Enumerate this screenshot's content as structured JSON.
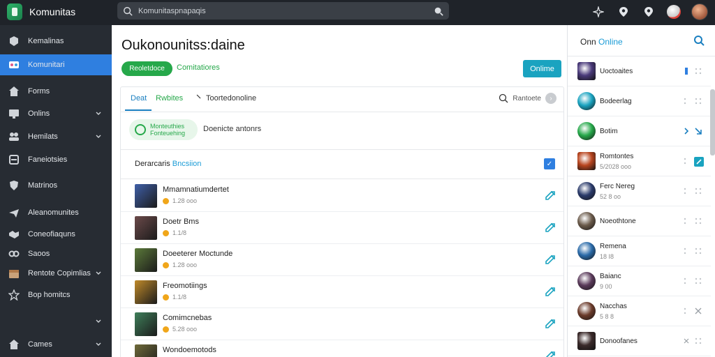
{
  "app": {
    "name": "Komunitas"
  },
  "search": {
    "placeholder": "Komunitaspnapaqis"
  },
  "sidebar": {
    "items": [
      {
        "label": "Kemalinas",
        "icon": "cube-icon",
        "chevron": false,
        "active": false
      },
      {
        "label": "Komunitari",
        "icon": "community-icon",
        "chevron": false,
        "active": true
      },
      {
        "label": "Forms",
        "icon": "house-icon",
        "chevron": false,
        "active": false
      },
      {
        "label": "Onlins",
        "icon": "monitor-icon",
        "chevron": true,
        "active": false
      },
      {
        "label": "Hemilats",
        "icon": "users-icon",
        "chevron": true,
        "active": false
      },
      {
        "label": "Faneiotsies",
        "icon": "tools-icon",
        "chevron": false,
        "active": false
      },
      {
        "label": "Matrinos",
        "icon": "shield-icon",
        "chevron": false,
        "active": false
      },
      {
        "label": "Aleanomunites",
        "icon": "plane-icon",
        "chevron": false,
        "active": false
      },
      {
        "label": "Coneofiaquns",
        "icon": "handshake-icon",
        "chevron": false,
        "active": false
      },
      {
        "label": "Saoos",
        "icon": "link-icon",
        "chevron": false,
        "active": false
      },
      {
        "label": "Rentote Copimlias",
        "icon": "calendar-icon",
        "chevron": true,
        "active": false
      },
      {
        "label": "Bop homitcs",
        "icon": "star-icon",
        "chevron": false,
        "active": false
      },
      {
        "label": "",
        "icon": "",
        "chevron": true,
        "active": false
      },
      {
        "label": "Cames",
        "icon": "home-icon",
        "chevron": true,
        "active": false
      }
    ]
  },
  "main": {
    "title": "Oukonounitss:daine",
    "green_button": "Reoletdoce",
    "green_link": "Comitatiores",
    "online_button": "Onlime",
    "tabs": [
      "Deat",
      "Rwbites",
      "Toortedonoline"
    ],
    "tab_right_label": "Rantoete",
    "filter": {
      "pill_line1": "Monteuthies",
      "pill_line2": "Fonteuehing",
      "label": "Doenicte antonrs"
    },
    "list_header": {
      "label": "Derarcaris",
      "accent": "Bncsiion"
    },
    "rows": [
      {
        "title": "Mmamnatiumdertet",
        "sub": "1.28 ooo",
        "thumb": "#3f5fa8"
      },
      {
        "title": "Doetr Bms",
        "sub": "1.1/8",
        "thumb": "#6b4a4a"
      },
      {
        "title": "Doeeterer Moctunde",
        "sub": "1.28 ooo",
        "thumb": "#5c7a3a"
      },
      {
        "title": "Freomotiings",
        "sub": "1.1/8",
        "thumb": "#c08a2a"
      },
      {
        "title": "Comimcnebas",
        "sub": "5.28 ooo",
        "thumb": "#3f7f5a"
      },
      {
        "title": "Wondoemotods",
        "sub": "",
        "thumb": "#6f6a3a"
      }
    ]
  },
  "right_panel": {
    "title_prefix": "Onn",
    "title_accent": "Online",
    "items": [
      {
        "name": "Uoctoaites",
        "sub": "",
        "avatar": "#4a3a7a",
        "shape": "sq",
        "mark": "bar"
      },
      {
        "name": "Bodeerlag",
        "sub": "",
        "avatar": "#1aa3c0",
        "shape": "round",
        "mark": "dots"
      },
      {
        "name": "Botim",
        "sub": "",
        "avatar": "#26a84a",
        "shape": "round",
        "mark": "chev"
      },
      {
        "name": "Romtontes",
        "sub": "5/2028 ooo",
        "avatar": "#b8451f",
        "shape": "sq",
        "mark": "teal"
      },
      {
        "name": "Ferc Nereg",
        "sub": "52 8 oo",
        "avatar": "#2a3a6a",
        "shape": "round",
        "mark": "dots"
      },
      {
        "name": "Noeothtone",
        "sub": "",
        "avatar": "#6a5a4a",
        "shape": "round",
        "mark": "dots"
      },
      {
        "name": "Remena",
        "sub": "18 I8",
        "avatar": "#2a6aa8",
        "shape": "round",
        "mark": "dots"
      },
      {
        "name": "Baianc",
        "sub": "9 00",
        "avatar": "#5a3a5a",
        "shape": "round",
        "mark": "dots"
      },
      {
        "name": "Nacchas",
        "sub": "5 8 8",
        "avatar": "#6a3a2a",
        "shape": "round",
        "mark": "x"
      },
      {
        "name": "Donoofanes",
        "sub": "",
        "avatar": "#3a2a2a",
        "shape": "sq",
        "mark": "x2"
      }
    ]
  },
  "colors": {
    "accent_blue": "#2f7fe0",
    "green": "#26a84a",
    "teal": "#1aa3c0",
    "dark": "#272c33"
  }
}
